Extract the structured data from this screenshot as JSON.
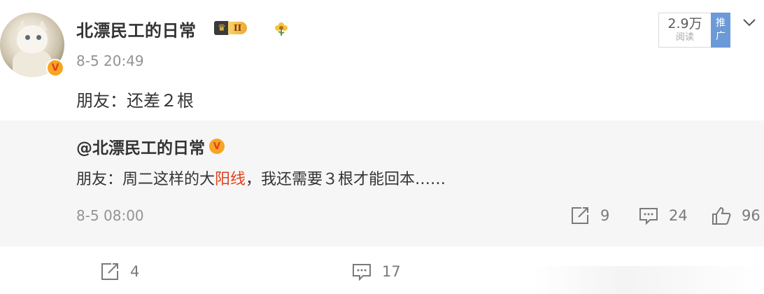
{
  "post": {
    "author": "北漂民工的日常",
    "member_level": "II",
    "timestamp": "8-5 20:49",
    "text": "朋友：还差２根",
    "reads": {
      "count": "2.9万",
      "label": "阅读"
    },
    "promote_label": "推广",
    "actions": {
      "repost_count": "4",
      "comment_count": "17"
    }
  },
  "quoted": {
    "author": "@北漂民工的日常",
    "text_before": "朋友：周二这样的大",
    "text_highlight": "阳线",
    "text_after": "，我还需要３根才能回本……",
    "timestamp": "8-5 08:00",
    "actions": {
      "repost_count": "9",
      "comment_count": "24",
      "like_count": "96"
    }
  },
  "colors": {
    "highlight": "#e2401b",
    "promote": "#6c9ad8",
    "badge": "#f6a623"
  },
  "icons": [
    "verified-v-icon",
    "crown-icon",
    "flower-icon",
    "chevron-down-icon",
    "repost-icon",
    "comment-icon",
    "like-icon"
  ]
}
